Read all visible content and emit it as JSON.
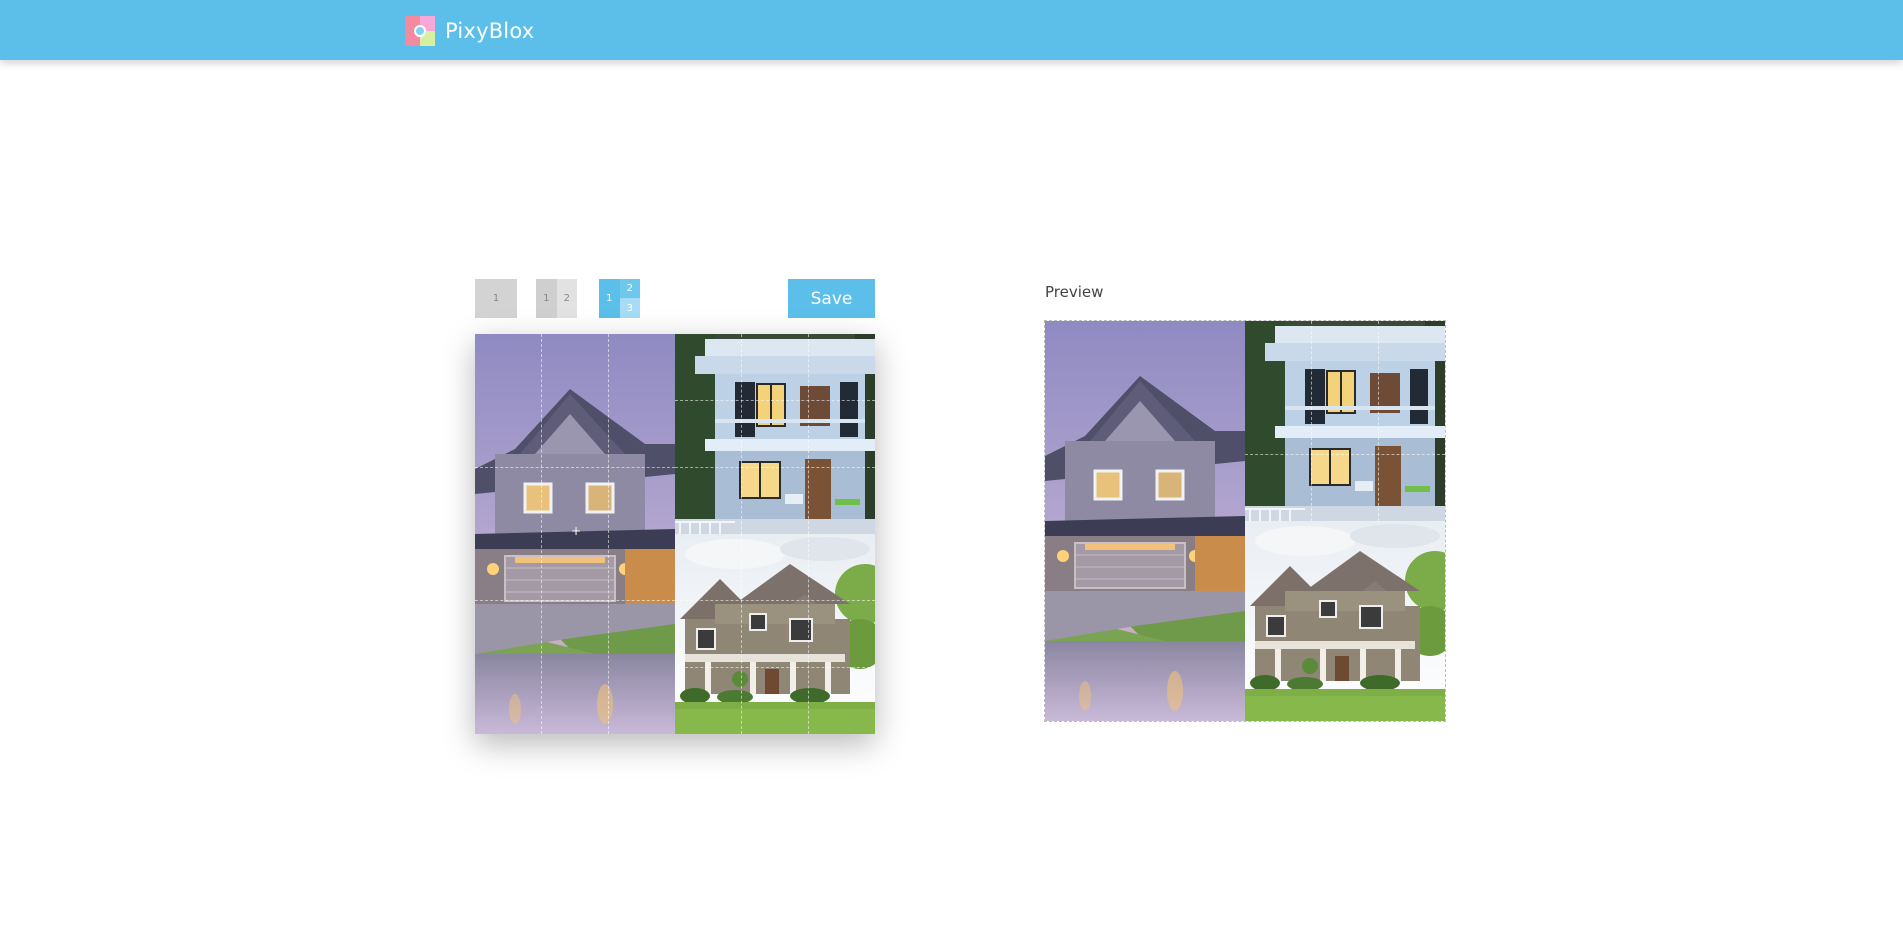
{
  "app": {
    "name": "PixyBlox"
  },
  "toolbar": {
    "layouts": [
      {
        "cells": [
          "1"
        ]
      },
      {
        "cells": [
          "1",
          "2"
        ]
      },
      {
        "cells": [
          "1",
          "2",
          "3"
        ]
      }
    ],
    "selected_layout": 3,
    "save_label": "Save"
  },
  "editor": {
    "tiles": [
      {
        "id": "1",
        "image": "house-dusk-garage"
      },
      {
        "id": "2",
        "image": "modern-white-house"
      },
      {
        "id": "3",
        "image": "suburban-house-lawn"
      }
    ]
  },
  "preview": {
    "label": "Preview"
  },
  "colors": {
    "accent": "#5bbfea",
    "button_inactive": "#d3d3d3"
  }
}
